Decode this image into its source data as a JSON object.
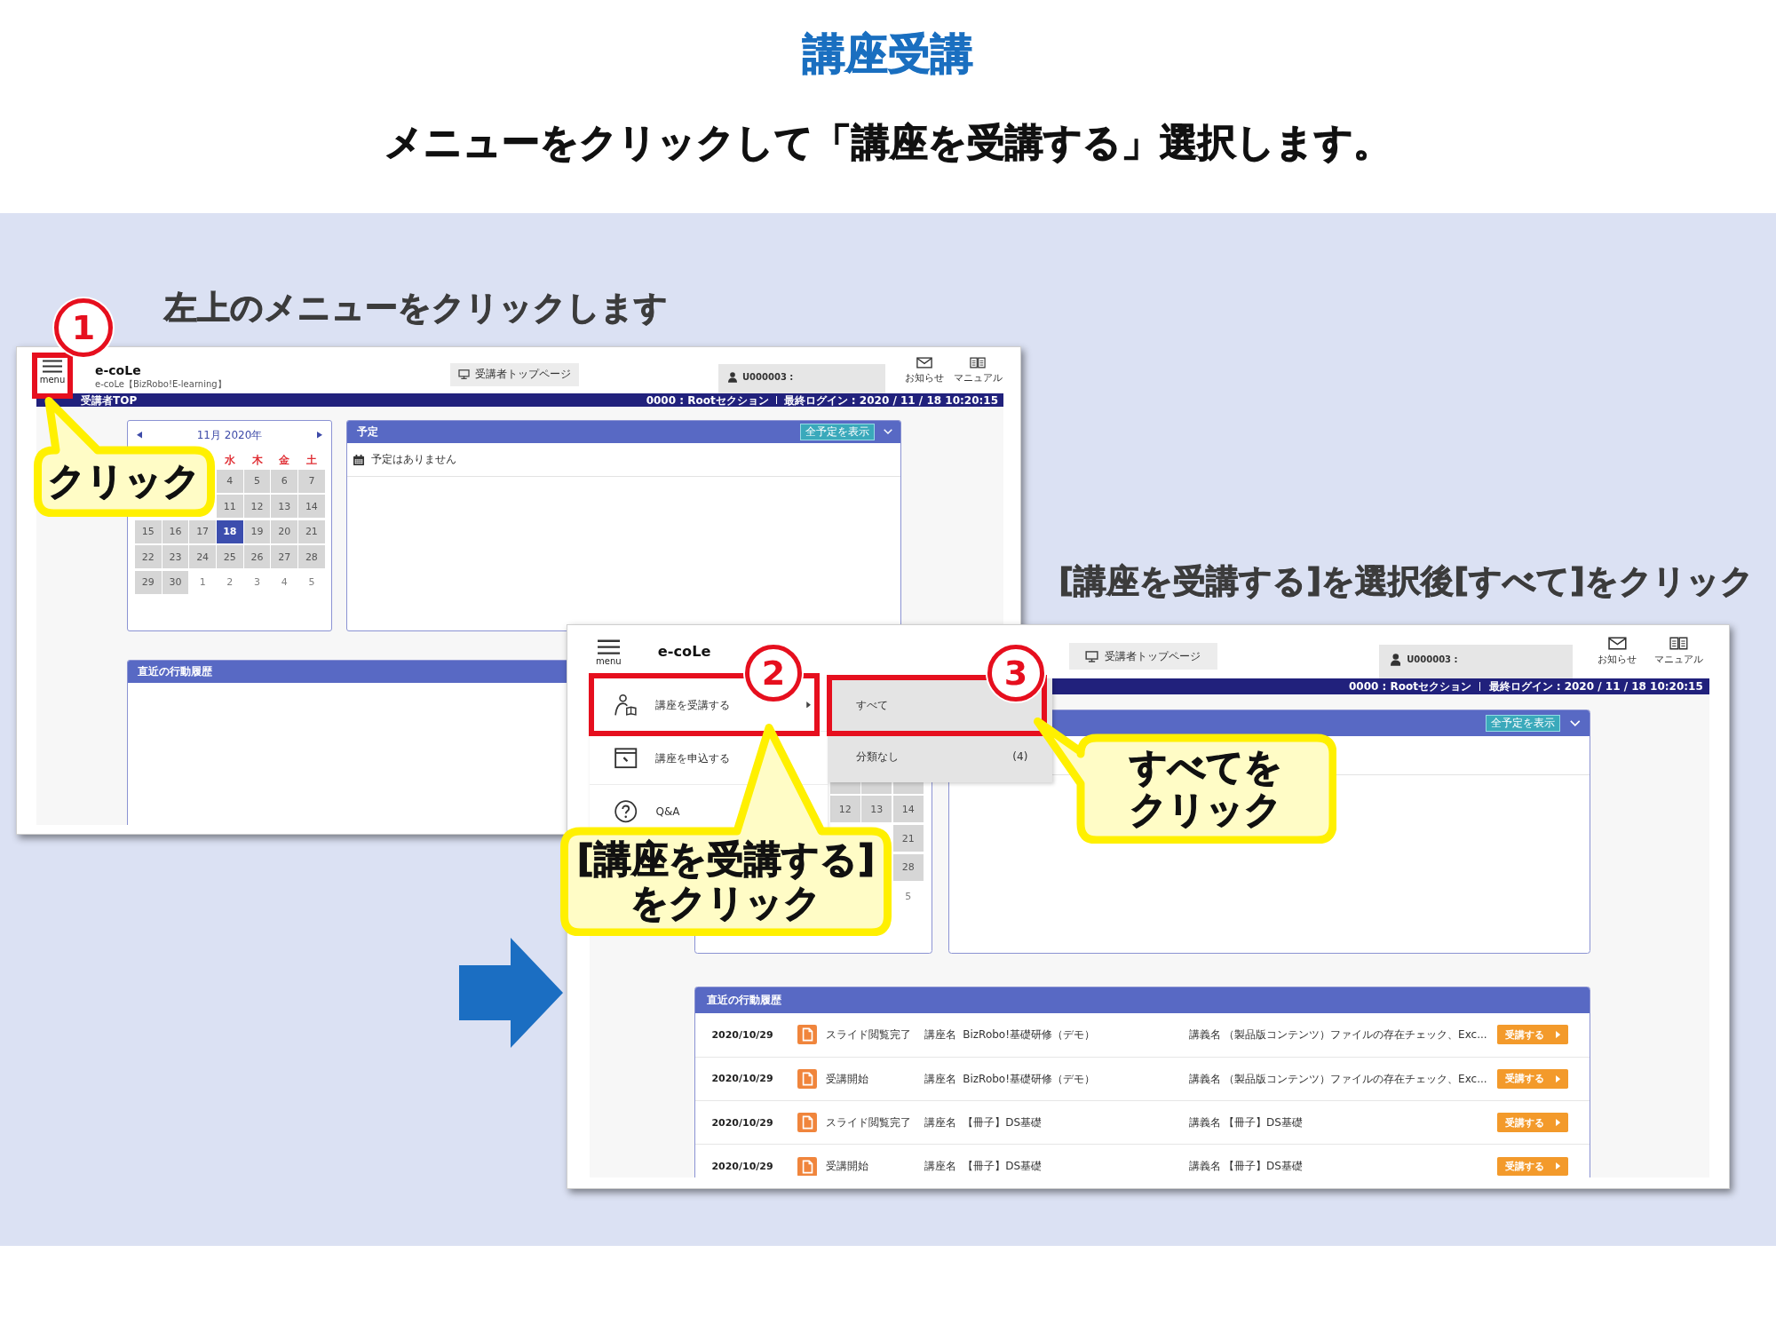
{
  "title": "講座受講",
  "subtitle": "メニューをクリックして「講座を受講する」選択します。",
  "steps": [
    {
      "caption": "左上のメニューをクリックします",
      "screen": {
        "header": {
          "menu_label": "menu",
          "logo": "e-coLe",
          "logo_subtitle": "e-coLe【BizRobo!E-learning】",
          "top_page_button": "受講者トップページ",
          "user": "U000003 :",
          "shortcuts": [
            {
              "kind": "mail",
              "label": "お知らせ"
            },
            {
              "kind": "manual",
              "label": "マニュアル"
            }
          ]
        },
        "nav": {
          "page_title": "受講者TOP",
          "section": "0000 : Rootセクション",
          "last_login": "最終ログイン : 2020 / 11 / 18 10:20:15"
        },
        "calendar": {
          "month": "11月 2020年",
          "weekdays": [
            "水",
            "木",
            "金",
            "土"
          ],
          "weeks": [
            [
              {
                "day": "4",
                "in_month": true,
                "selected": false
              },
              {
                "day": "5",
                "in_month": true,
                "selected": false
              },
              {
                "day": "6",
                "in_month": true,
                "selected": false
              },
              {
                "day": "7",
                "in_month": true,
                "selected": false
              }
            ],
            [
              {
                "day": "11",
                "in_month": true,
                "selected": false
              },
              {
                "day": "12",
                "in_month": true,
                "selected": false
              },
              {
                "day": "13",
                "in_month": true,
                "selected": false
              },
              {
                "day": "14",
                "in_month": true,
                "selected": false
              }
            ],
            [
              {
                "day": "15",
                "in_month": true,
                "selected": false
              },
              {
                "day": "16",
                "in_month": true,
                "selected": false
              },
              {
                "day": "17",
                "in_month": true,
                "selected": false
              },
              {
                "day": "18",
                "in_month": true,
                "selected": true
              },
              {
                "day": "19",
                "in_month": true,
                "selected": false
              },
              {
                "day": "20",
                "in_month": true,
                "selected": false
              },
              {
                "day": "21",
                "in_month": true,
                "selected": false
              }
            ],
            [
              {
                "day": "22",
                "in_month": true,
                "selected": false
              },
              {
                "day": "23",
                "in_month": true,
                "selected": false
              },
              {
                "day": "24",
                "in_month": true,
                "selected": false
              },
              {
                "day": "25",
                "in_month": true,
                "selected": false
              },
              {
                "day": "26",
                "in_month": true,
                "selected": false
              },
              {
                "day": "27",
                "in_month": true,
                "selected": false
              },
              {
                "day": "28",
                "in_month": true,
                "selected": false
              }
            ],
            [
              {
                "day": "29",
                "in_month": true,
                "selected": false
              },
              {
                "day": "30",
                "in_month": true,
                "selected": false
              },
              {
                "day": "1",
                "in_month": false,
                "selected": false
              },
              {
                "day": "2",
                "in_month": false,
                "selected": false
              },
              {
                "day": "3",
                "in_month": false,
                "selected": false
              },
              {
                "day": "4",
                "in_month": false,
                "selected": false
              },
              {
                "day": "5",
                "in_month": false,
                "selected": false
              }
            ]
          ]
        },
        "schedule": {
          "title": "予定",
          "show_all_button": "全予定を表示",
          "empty_message": "予定はありません"
        },
        "history": {
          "title": "直近の行動履歴"
        }
      }
    },
    {
      "caption": "[講座を受講する]を選択後[すべて]をクリック",
      "screen": {
        "header": {
          "menu_label": "menu",
          "logo": "e-coLe",
          "top_page_button": "受講者トップページ",
          "user": "U000003 :",
          "shortcuts": [
            {
              "kind": "mail",
              "label": "お知らせ"
            },
            {
              "kind": "manual",
              "label": "マニュアル"
            }
          ]
        },
        "nav": {
          "section": "0000 : Rootセクション",
          "last_login": "最終ログイン : 2020 / 11 / 18 10:20:15"
        },
        "calendar": {
          "weeks": [
            [
              {
                "in_month": true,
                "selected": false
              },
              {
                "in_month": true,
                "selected": false
              },
              {
                "in_month": true,
                "selected": false
              }
            ],
            [
              {
                "day": "12",
                "in_month": true,
                "selected": false
              },
              {
                "day": "13",
                "in_month": true,
                "selected": false
              },
              {
                "day": "14",
                "in_month": true,
                "selected": false
              }
            ],
            [
              {
                "day": "21",
                "in_month": true,
                "selected": false
              }
            ],
            [
              {
                "day": "28",
                "in_month": true,
                "selected": false
              }
            ],
            [
              {
                "day": "5",
                "in_month": false,
                "selected": false
              }
            ]
          ]
        },
        "schedule": {
          "show_all_button": "全予定を表示"
        },
        "history": {
          "title": "直近の行動履歴",
          "rows": [
            {
              "date": "2020/10/29",
              "action": "スライド閲覧完了",
              "course_label": "講座名",
              "course": "BizRobo!基礎研修（デモ）",
              "lecture_label": "講義名",
              "lecture": "（製品版コンテンツ）ファイルの存在チェック、Exc...",
              "button": "受講する"
            },
            {
              "date": "2020/10/29",
              "action": "受講開始",
              "course_label": "講座名",
              "course": "BizRobo!基礎研修（デモ）",
              "lecture_label": "講義名",
              "lecture": "（製品版コンテンツ）ファイルの存在チェック、Exc...",
              "button": "受講する"
            },
            {
              "date": "2020/10/29",
              "action": "スライド閲覧完了",
              "course_label": "講座名",
              "course": "【冊子】DS基礎",
              "lecture_label": "講義名",
              "lecture": "【冊子】DS基礎",
              "button": "受講する"
            },
            {
              "date": "2020/10/29",
              "action": "受講開始",
              "course_label": "講座名",
              "course": "【冊子】DS基礎",
              "lecture_label": "講義名",
              "lecture": "【冊子】DS基礎",
              "button": "受講する"
            }
          ]
        },
        "side_menu": {
          "items": [
            {
              "kind": "course",
              "label": "講座を受講する",
              "has_submenu": true
            },
            {
              "kind": "apply",
              "label": "講座を申込する",
              "has_submenu": false
            },
            {
              "kind": "help",
              "label": "Q&A"
            }
          ],
          "submenu": [
            {
              "label": "すべて"
            },
            {
              "label": "分類なし",
              "count": "(4)"
            }
          ]
        }
      }
    }
  ],
  "callouts": [
    {
      "number": "1",
      "text": "クリック"
    },
    {
      "number": "2",
      "text": "[講座を受講する]をクリック"
    },
    {
      "number": "3",
      "text": "すべてをクリック"
    }
  ]
}
